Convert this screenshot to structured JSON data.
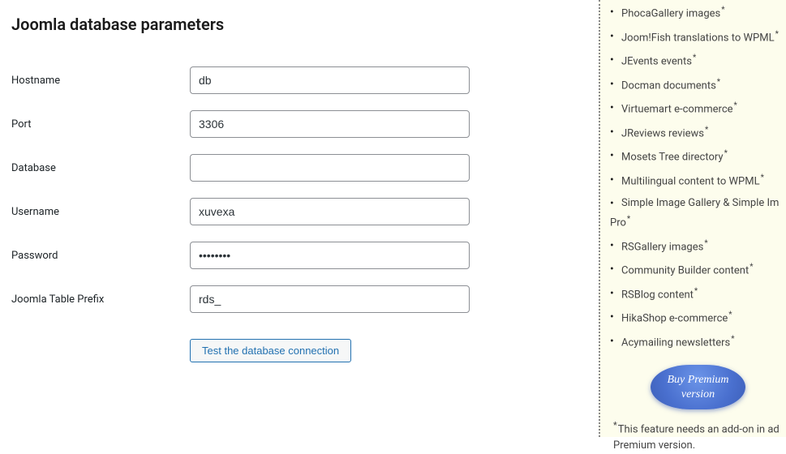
{
  "page": {
    "title": "Joomla database parameters"
  },
  "form": {
    "hostname": {
      "label": "Hostname",
      "value": "db"
    },
    "port": {
      "label": "Port",
      "value": "3306"
    },
    "database": {
      "label": "Database",
      "value": ""
    },
    "username": {
      "label": "Username",
      "value": "xuvexa"
    },
    "password": {
      "label": "Password",
      "value": "••••••••"
    },
    "table_prefix": {
      "label": "Joomla Table Prefix",
      "value": "rds_"
    },
    "test_button": "Test the database connection"
  },
  "sidebar": {
    "items": [
      {
        "text": "PhocaGallery images",
        "star": true
      },
      {
        "text": "Joom!Fish translations to WPML",
        "star": true
      },
      {
        "text": "JEvents events",
        "star": true
      },
      {
        "text": "Docman documents",
        "star": true
      },
      {
        "text": "Virtuemart e-commerce",
        "star": true
      },
      {
        "text": "JReviews reviews",
        "star": true
      },
      {
        "text": "Mosets Tree directory",
        "star": true
      },
      {
        "text": "Multilingual content to WPML",
        "star": true
      },
      {
        "text": "Simple Image Gallery & Simple Im",
        "star": false,
        "continuation_text": "Pro",
        "continuation_star": true
      },
      {
        "text": "RSGallery images",
        "star": true
      },
      {
        "text": "Community Builder content",
        "star": true
      },
      {
        "text": "RSBlog content",
        "star": true
      },
      {
        "text": "HikaShop e-commerce",
        "star": true
      },
      {
        "text": "Acymailing newsletters",
        "star": true
      }
    ],
    "buy_button": "Buy Premium version",
    "footnote": "This feature needs an add-on in ad",
    "footnote_line2": "Premium version."
  }
}
